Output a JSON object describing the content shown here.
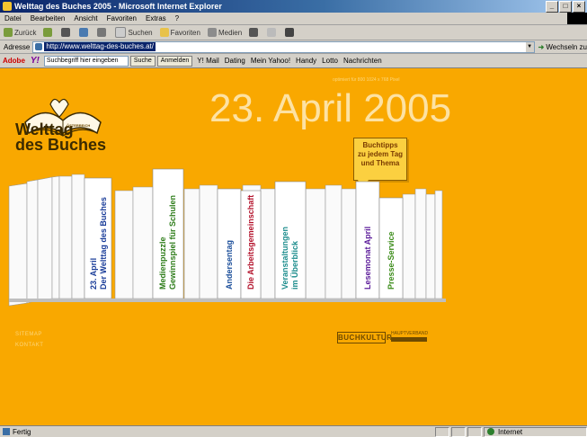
{
  "window": {
    "title": "Welttag des Buches 2005 - Microsoft Internet Explorer",
    "controls": [
      "_",
      "□",
      "×"
    ]
  },
  "menu": [
    "Datei",
    "Bearbeiten",
    "Ansicht",
    "Favoriten",
    "Extras",
    "?"
  ],
  "toolbar": {
    "back": "Zurück",
    "search": "Suchen",
    "favorites": "Favoriten",
    "media": "Medien"
  },
  "address": {
    "label": "Adresse",
    "url": "http://www.welttag-des-buches.at/",
    "go": "Wechseln zu"
  },
  "yahoo": {
    "adobe": "Adobe",
    "search_placeholder": "Suchbegriff hier eingeben",
    "search_btn": "Suche",
    "items": [
      "Anmelden",
      "Y! Mail",
      "Dating",
      "Mein Yahoo!",
      "Handy",
      "Lotto",
      "Nachrichten"
    ]
  },
  "page": {
    "ruler_note": "optimiert für 800 1024 x 768 Pixel",
    "date": "23. April 2005",
    "logo_small": "ÖSTERREICH",
    "logo_line1": "Welttag",
    "logo_line2": "des Buches",
    "bubble": [
      "Buchtipps",
      "zu jedem Tag",
      "und Thema"
    ],
    "books": [
      {
        "line1": "23. April",
        "line2": "Der Welttag des Buches",
        "color": "#1a3d99"
      },
      {
        "line1": "Medienpuzzle",
        "line2": "Gewinnspiel für Schulen",
        "color": "#2e7d1a"
      },
      {
        "line1": "Andersentag",
        "line2": "",
        "color": "#1a4d99"
      },
      {
        "line1": "Die Arbeitsgemeinschaft",
        "line2": "",
        "color": "#b3122b"
      },
      {
        "line1": "Veranstaltungen",
        "line2": "im Überblick",
        "color": "#1b8c8c"
      },
      {
        "line1": "Lesemonat April",
        "line2": "",
        "color": "#5a1a99"
      },
      {
        "line1": "Presse-Service",
        "line2": "",
        "color": "#3c8c1a"
      }
    ],
    "nav": [
      "SITEMAP",
      "KONTAKT"
    ],
    "sponsor1": "BUCHKULTUR",
    "sponsor2": "HAUPTVERBAND"
  },
  "status": {
    "left": "Fertig",
    "zone": "Internet"
  }
}
